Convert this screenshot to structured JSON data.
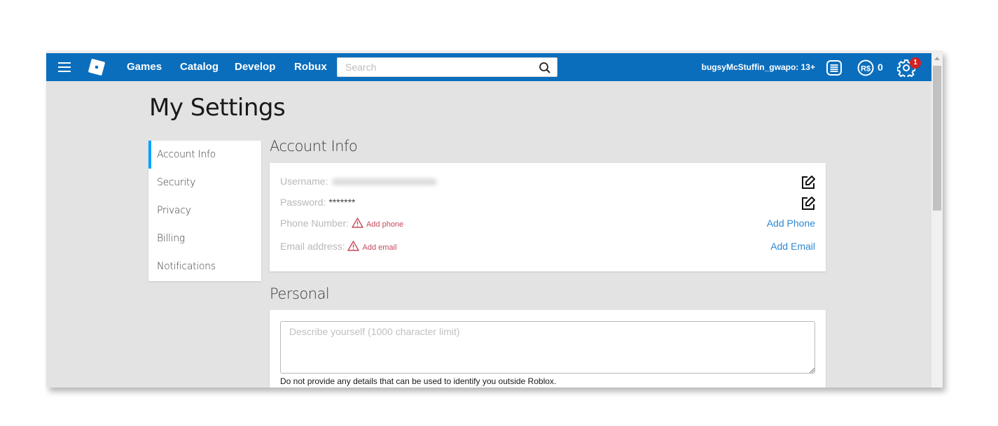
{
  "topbar": {
    "nav": [
      "Games",
      "Catalog",
      "Develop",
      "Robux"
    ],
    "search_placeholder": "Search",
    "username": "bugsyMcStuffin_gwapo: 13+",
    "robux_count": "0",
    "notification_count": "1",
    "brand_color": "#0a6ebd"
  },
  "page": {
    "title": "My Settings"
  },
  "sidemenu": {
    "items": [
      "Account Info",
      "Security",
      "Privacy",
      "Billing",
      "Notifications"
    ],
    "active": "Account Info"
  },
  "account_info": {
    "title": "Account Info",
    "username_label": "Username:",
    "username_value": "(blurred)",
    "password_label": "Password:",
    "password_value": "*******",
    "phone_label": "Phone Number:",
    "phone_warning": "Add phone",
    "phone_action": "Add Phone",
    "email_label": "Email address:",
    "email_warning": "Add email",
    "email_action": "Add Email"
  },
  "personal": {
    "title": "Personal",
    "about_placeholder": "Describe yourself (1000 character limit)",
    "about_value": "",
    "note": "Do not provide any details that can be used to identify you outside Roblox."
  }
}
